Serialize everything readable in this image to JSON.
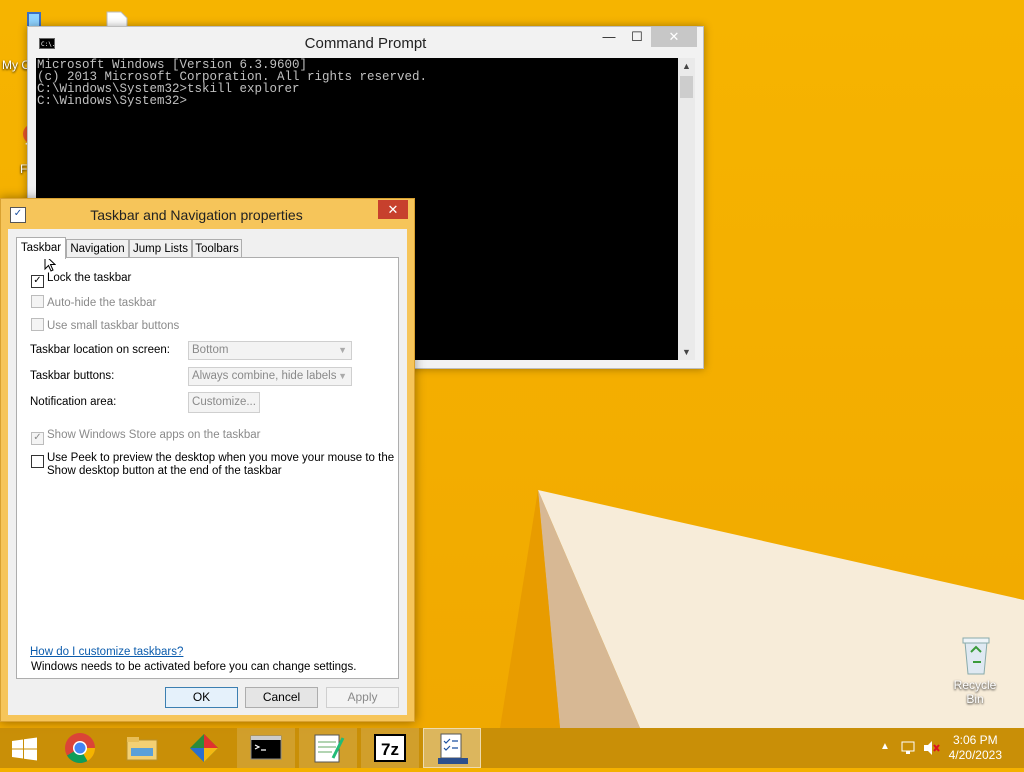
{
  "desktop": {
    "icons": [
      {
        "label": "My C"
      },
      {
        "label": "F"
      },
      {
        "label": "Recycle Bin"
      }
    ]
  },
  "cmd": {
    "title": "Command Prompt",
    "lines": [
      "Microsoft Windows [Version 6.3.9600]",
      "(c) 2013 Microsoft Corporation. All rights reserved.",
      "",
      "C:\\Windows\\System32>tskill explorer",
      "",
      "C:\\Windows\\System32>"
    ],
    "minimize": "—",
    "maximize": "☐",
    "close": "✕"
  },
  "dialog": {
    "title": "Taskbar and Navigation properties",
    "close": "✕",
    "tabs": [
      {
        "label": "Taskbar",
        "active": true
      },
      {
        "label": "Navigation"
      },
      {
        "label": "Jump Lists"
      },
      {
        "label": "Toolbars"
      }
    ],
    "lock_taskbar": {
      "label": "Lock the taskbar",
      "checked": true
    },
    "auto_hide": {
      "label": "Auto-hide the taskbar",
      "checked": false
    },
    "small_buttons": {
      "label": "Use small taskbar buttons",
      "checked": false
    },
    "location_label": "Taskbar location on screen:",
    "location_value": "Bottom",
    "buttons_label": "Taskbar buttons:",
    "buttons_value": "Always combine, hide labels",
    "notification_label": "Notification area:",
    "customize_button": "Customize...",
    "store_apps": {
      "label": "Show Windows Store apps on the taskbar",
      "checked": true
    },
    "peek": {
      "label_line1": "Use Peek to preview the desktop when you move your mouse to the",
      "label_line2": "Show desktop button at the end of the taskbar",
      "checked": false
    },
    "help_link": "How do I customize taskbars?",
    "activation_note": "Windows needs to be activated before you can change settings.",
    "ok": "OK",
    "cancel": "Cancel",
    "apply": "Apply"
  },
  "taskbar": {
    "items": [
      "start-button",
      "chrome-icon",
      "file-explorer-icon",
      "app-icon",
      "command-prompt-icon",
      "notepad-icon",
      "7zip-icon",
      "taskbar-properties-icon"
    ],
    "sevenzip_label": "7z",
    "time": "3:06 PM",
    "date": "4/20/2023"
  }
}
